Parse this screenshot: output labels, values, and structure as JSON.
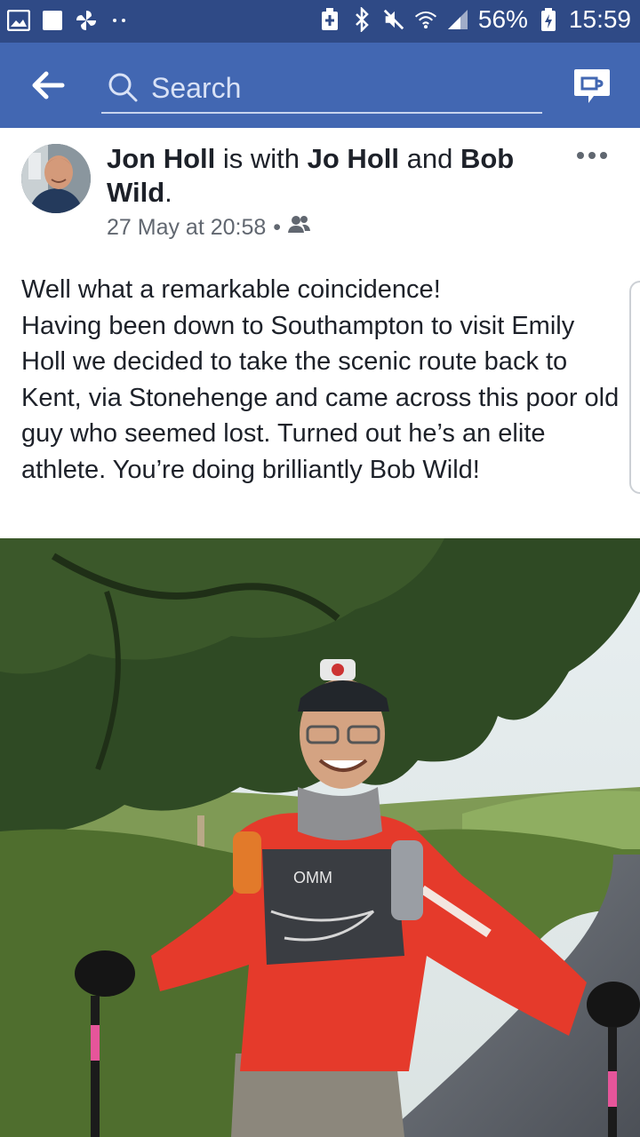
{
  "status_bar": {
    "battery_percent": "56%",
    "time": "15:59",
    "left_icons": [
      "gallery-icon",
      "square-icon",
      "pinwheel-icon",
      "more-dots-icon"
    ],
    "right_icons": [
      "battery-saver-icon",
      "bluetooth-icon",
      "mute-icon",
      "wifi-icon",
      "signal-icon",
      "battery-icon"
    ]
  },
  "top_bar": {
    "search_placeholder": "Search",
    "icons": [
      "back-arrow-icon",
      "search-icon",
      "messenger-icon"
    ]
  },
  "post": {
    "author": "Jon Holl",
    "with_text": " is with ",
    "tagged_1": "Jo Holl",
    "and_text": " and ",
    "tagged_2": "Bob Wild",
    "period": ".",
    "timestamp": "27 May at 20:58",
    "separator": "•",
    "privacy_icon": "friends-icon",
    "text": "Well what a remarkable coincidence!\nHaving been down to Southampton to visit Emily Holl we decided to take the scenic route back to Kent, via Stonehenge and came across this poor old guy who seemed lost. Turned out he’s an elite athlete. You’re doing brilliantly Bob Wild!"
  },
  "photo": {
    "vest_brand": "OMM",
    "colors": {
      "sky": "#dfe8ea",
      "shirt": "#e53a2b",
      "grass": "#6b8a3c"
    }
  }
}
